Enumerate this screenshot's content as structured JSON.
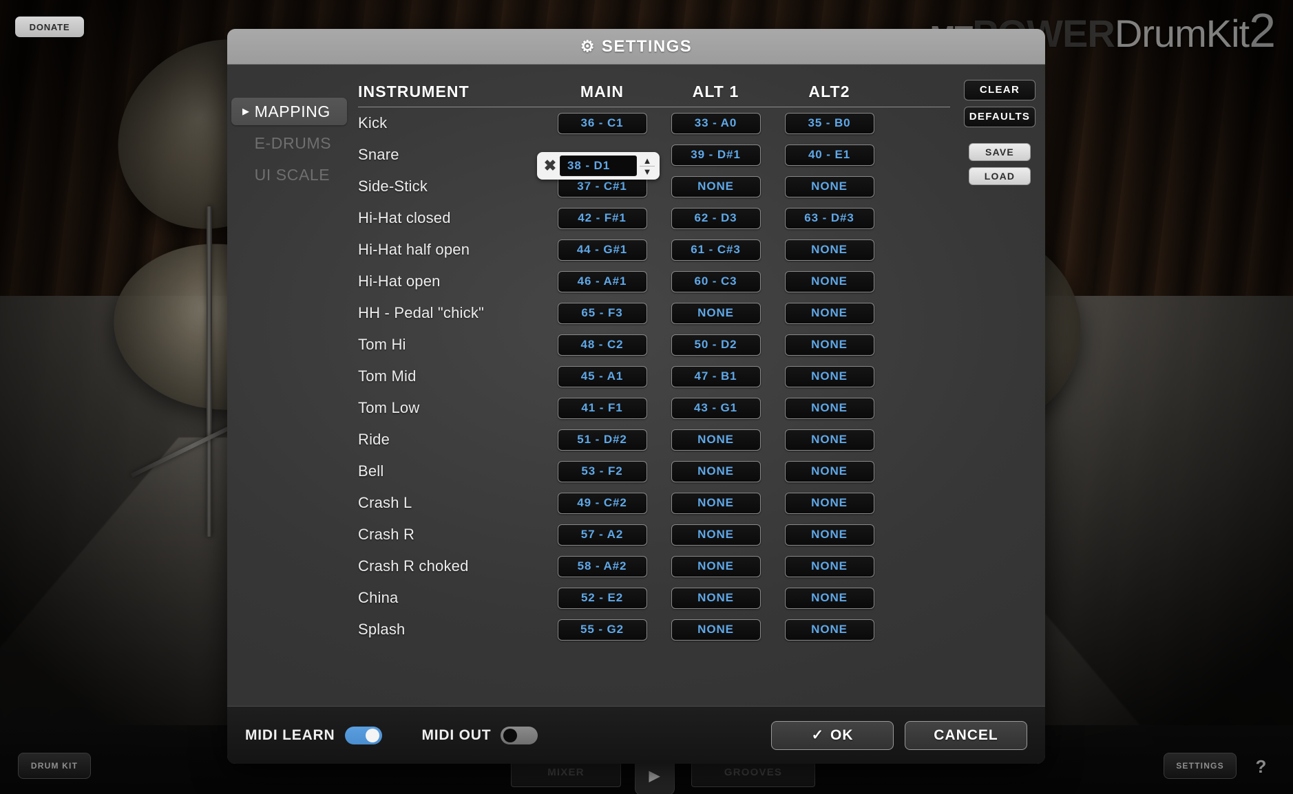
{
  "host": {
    "donate_label": "DONATE",
    "drumkit_label": "DRUM KIT",
    "mixer_label": "MIXER",
    "grooves_label": "GROOVES",
    "settings_label": "SETTINGS",
    "help_label": "?",
    "play_label": "▶",
    "logo": {
      "mt": "MT",
      "power": "POWER",
      "drumkit": "DrumKit",
      "version": "2"
    }
  },
  "dialog": {
    "title": "SETTINGS",
    "gear_icon": "⚙"
  },
  "nav": {
    "items": [
      {
        "label": "MAPPING",
        "active": true
      },
      {
        "label": "E-DRUMS",
        "active": false
      },
      {
        "label": "UI SCALE",
        "active": false
      }
    ]
  },
  "actions": {
    "clear_label": "CLEAR",
    "defaults_label": "DEFAULTS",
    "save_label": "SAVE",
    "load_label": "LOAD"
  },
  "table": {
    "headers": [
      "INSTRUMENT",
      "MAIN",
      "ALT 1",
      "ALT2"
    ],
    "rows": [
      {
        "instrument": "Kick",
        "main": "36 - C1",
        "alt1": "33 - A0",
        "alt2": "35 - B0"
      },
      {
        "instrument": "Snare",
        "main": "38 - D1",
        "alt1": "39 - D#1",
        "alt2": "40 - E1",
        "editing": true
      },
      {
        "instrument": "Side-Stick",
        "main": "37 - C#1",
        "alt1": "NONE",
        "alt2": "NONE"
      },
      {
        "instrument": "Hi-Hat closed",
        "main": "42 - F#1",
        "alt1": "62 - D3",
        "alt2": "63 - D#3"
      },
      {
        "instrument": "Hi-Hat half open",
        "main": "44 - G#1",
        "alt1": "61 - C#3",
        "alt2": "NONE"
      },
      {
        "instrument": "Hi-Hat open",
        "main": "46 - A#1",
        "alt1": "60 - C3",
        "alt2": "NONE"
      },
      {
        "instrument": "HH - Pedal \"chick\"",
        "main": "65 - F3",
        "alt1": "NONE",
        "alt2": "NONE"
      },
      {
        "instrument": "Tom Hi",
        "main": "48 - C2",
        "alt1": "50 - D2",
        "alt2": "NONE"
      },
      {
        "instrument": "Tom Mid",
        "main": "45 - A1",
        "alt1": "47 - B1",
        "alt2": "NONE"
      },
      {
        "instrument": "Tom Low",
        "main": "41 - F1",
        "alt1": "43 - G1",
        "alt2": "NONE"
      },
      {
        "instrument": "Ride",
        "main": "51 - D#2",
        "alt1": "NONE",
        "alt2": "NONE"
      },
      {
        "instrument": "Bell",
        "main": "53 - F2",
        "alt1": "NONE",
        "alt2": "NONE"
      },
      {
        "instrument": "Crash L",
        "main": "49 - C#2",
        "alt1": "NONE",
        "alt2": "NONE"
      },
      {
        "instrument": "Crash R",
        "main": "57 - A2",
        "alt1": "NONE",
        "alt2": "NONE"
      },
      {
        "instrument": "Crash R choked",
        "main": "58 - A#2",
        "alt1": "NONE",
        "alt2": "NONE"
      },
      {
        "instrument": "China",
        "main": "52 - E2",
        "alt1": "NONE",
        "alt2": "NONE"
      },
      {
        "instrument": "Splash",
        "main": "55 - G2",
        "alt1": "NONE",
        "alt2": "NONE"
      }
    ],
    "editor": {
      "clear_icon": "✖",
      "value": "38 - D1",
      "up_arrow": "▲",
      "down_arrow": "▼"
    }
  },
  "footer": {
    "midi_learn_label": "MIDI LEARN",
    "midi_learn_on": true,
    "midi_out_label": "MIDI OUT",
    "midi_out_on": false,
    "ok_label": "OK",
    "ok_check": "✓",
    "cancel_label": "CANCEL"
  },
  "colors": {
    "note_blue": "#5fa8e8",
    "toggle_on": "#4e93d4",
    "title_bar": "#a0a0a0"
  }
}
